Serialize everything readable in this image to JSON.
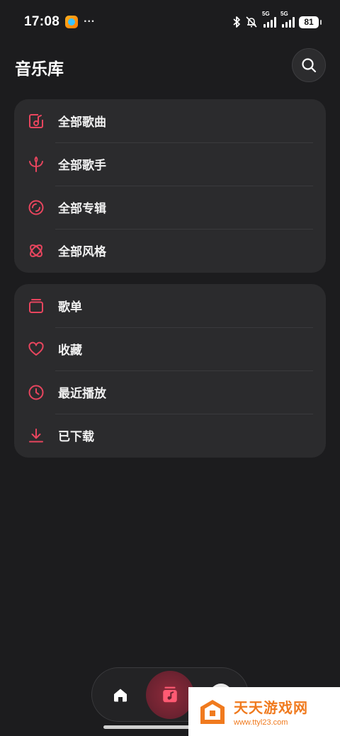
{
  "status_bar": {
    "time": "17:08",
    "dots": "···",
    "network_1": "5G",
    "network_2": "5G",
    "battery": "81"
  },
  "header": {
    "title": "音乐库"
  },
  "library_sections": [
    {
      "label": "全部歌曲",
      "icon": "music-box-icon"
    },
    {
      "label": "全部歌手",
      "icon": "singer-icon"
    },
    {
      "label": "全部专辑",
      "icon": "album-disc-icon"
    },
    {
      "label": "全部风格",
      "icon": "genre-atom-icon"
    }
  ],
  "personal_sections": [
    {
      "label": "歌单",
      "icon": "playlist-icon"
    },
    {
      "label": "收藏",
      "icon": "heart-icon"
    },
    {
      "label": "最近播放",
      "icon": "clock-icon"
    },
    {
      "label": "已下载",
      "icon": "download-icon"
    }
  ],
  "bottom_nav": {
    "items": [
      "home-icon",
      "library-icon",
      "profile-icon"
    ],
    "active": "library-icon"
  },
  "watermark": {
    "name": "天天游戏网",
    "url": "www.ttyl23.com"
  },
  "colors": {
    "background": "#1c1c1e",
    "card": "#2b2b2d",
    "accent": "#e8455e"
  }
}
